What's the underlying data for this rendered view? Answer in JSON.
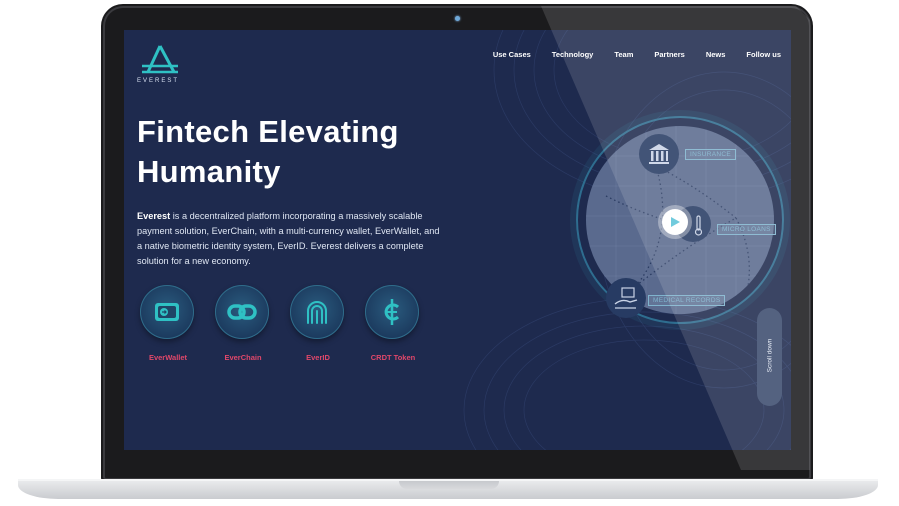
{
  "brand": {
    "name": "EVEREST"
  },
  "nav": {
    "items": [
      {
        "label": "Use Cases"
      },
      {
        "label": "Technology"
      },
      {
        "label": "Team"
      },
      {
        "label": "Partners"
      },
      {
        "label": "News"
      },
      {
        "label": "Follow us"
      }
    ]
  },
  "hero": {
    "title_line1": "Fintech Elevating",
    "title_line2": "Humanity",
    "body_bold": "Everest",
    "body_rest": " is a decentralized platform incorporating a massively scalable payment solution, EverChain, with a multi-currency wallet, EverWallet, and a native biometric identity system, EverID. Everest delivers a complete solution for a new economy."
  },
  "products": [
    {
      "label": "EverWallet",
      "icon": "wallet-icon"
    },
    {
      "label": "EverChain",
      "icon": "chain-link-icon"
    },
    {
      "label": "EverID",
      "icon": "fingerprint-icon"
    },
    {
      "label": "CRDT Token",
      "icon": "crdt-token-icon"
    }
  ],
  "orb": {
    "tags": {
      "insurance": "INSURANCE",
      "micro_loans": "MICRO LOANS",
      "medical_records": "MEDICAL RECORDS"
    },
    "icons": [
      "bank-icon",
      "thermometer-icon",
      "hand-document-icon"
    ]
  },
  "play": {
    "icon": "play-icon"
  },
  "scroll": {
    "label": "Scroll down"
  },
  "colors": {
    "background": "#1e2a4e",
    "accent_pink": "#e0476a",
    "teal": "#2fc1c4",
    "tag_blue": "#7fb3cd"
  }
}
